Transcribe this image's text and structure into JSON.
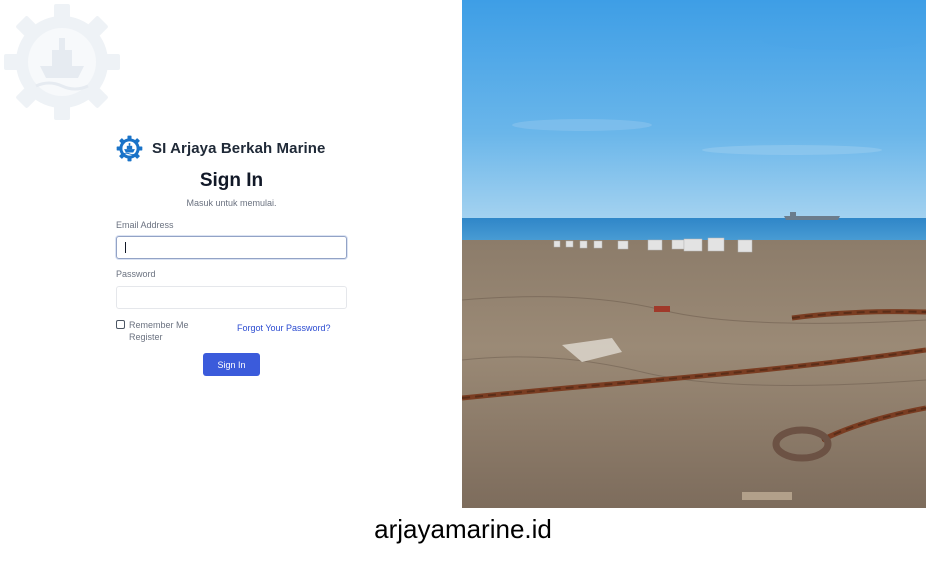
{
  "brand": {
    "name": "SI Arjaya Berkah Marine",
    "logo_icon": "ship-gear-logo-icon",
    "primary_color": "#1a73c8"
  },
  "login": {
    "title": "Sign In",
    "subtitle": "Masuk untuk memulai.",
    "email_label": "Email Address",
    "email_value": "",
    "password_label": "Password",
    "password_value": "",
    "remember_label": "Remember Me",
    "remember_checked": false,
    "register_label": "Register",
    "forgot_label": "Forgot Your Password?",
    "submit_label": "Sign In",
    "button_color": "#3b5bdb",
    "link_color": "#2b4bd1"
  },
  "photo": {
    "subject": "shipyard-shore-with-anchor-chains"
  },
  "footer": {
    "caption": "arjayamarine.id"
  }
}
